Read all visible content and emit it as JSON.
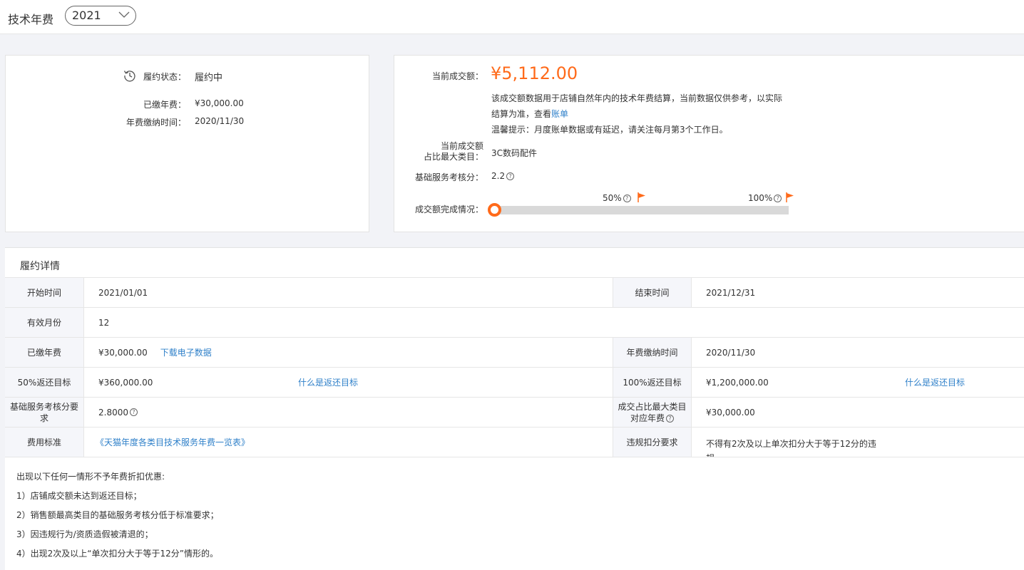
{
  "header": {
    "title": "技术年费",
    "year": "2021"
  },
  "status_card": {
    "status_label": "履约状态：",
    "status_value": "履约中",
    "paid_label": "已缴年费：",
    "paid_value": "¥30,000.00",
    "pay_time_label": "年费缴纳时间：",
    "pay_time_value": "2020/11/30"
  },
  "sales_card": {
    "amount_label": "当前成交额：",
    "amount_value": "¥5,112.00",
    "desc_line1": "该成交额数据用于店铺自然年内的技术年费结算，当前数据仅供参考，以实际",
    "desc_line2_prefix": "结算为准，查看",
    "bill_link": "账单",
    "tip": "温馨提示：月度账单数据或有延迟，请关注每月第3个工作日。",
    "top_category_label_1": "当前成交额",
    "top_category_label_2": "占比最大类目：",
    "top_category_value": "3C数码配件",
    "score_label": "基础服务考核分：",
    "score_value": "2.2",
    "progress_label": "成交额完成情况：",
    "progress_fraction": 0.0043,
    "marker_50": "50%",
    "marker_100": "100%",
    "accent_color": "#ff6a1a"
  },
  "detail": {
    "title": "履约详情",
    "start_label": "开始时间",
    "start_value": "2021/01/01",
    "end_label": "结束时间",
    "end_value": "2021/12/31",
    "months_label": "有效月份",
    "months_value": "12",
    "paid_label": "已缴年费",
    "paid_value": "¥30,000.00",
    "download_link": "下载电子数据",
    "pay_time_label": "年费缴纳时间",
    "pay_time_value": "2020/11/30",
    "target50_label": "50%返还目标",
    "target50_value": "¥360,000.00",
    "target50_link": "什么是返还目标",
    "target100_label": "100%返还目标",
    "target100_value": "¥1,200,000.00",
    "target100_link": "什么是返还目标",
    "score_req_label": "基础服务考核分要求",
    "score_req_value": "2.8000",
    "cat_fee_label_1": "成交占比最大类目",
    "cat_fee_label_2": "对应年费",
    "cat_fee_value": "¥30,000.00",
    "fee_std_label": "费用标准",
    "fee_std_link": "《天猫年度各类目技术服务年费一览表》",
    "violation_label": "违规扣分要求",
    "violation_value_1": "不得有2次及以上单次扣分大于等于12分的违",
    "violation_value_2": "规"
  },
  "notes": [
    "出现以下任何一情形不予年费折扣优惠:",
    "1）店铺成交额未达到返还目标；",
    "2）销售额最高类目的基础服务考核分低于标准要求；",
    "3）因违规行为/资质造假被清退的；",
    "4）出现2次及以上“单次扣分大于等于12分”情形的。"
  ]
}
